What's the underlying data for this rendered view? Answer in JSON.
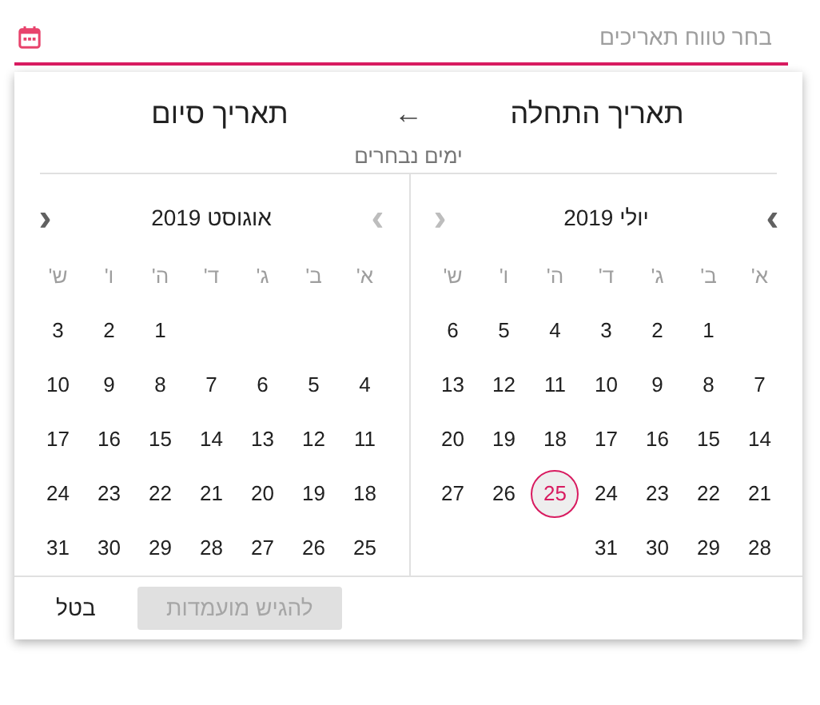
{
  "field": {
    "placeholder": "בחר טווח תאריכים"
  },
  "header": {
    "start_label": "תאריך התחלה",
    "arrow": "←",
    "end_label": "תאריך סיום",
    "subtitle": "ימים נבחרים"
  },
  "months": [
    {
      "title": "יולי 2019",
      "prev": {
        "label": "›",
        "disabled": false
      },
      "next": {
        "label": "‹",
        "disabled": true
      },
      "weekdays": [
        "א'",
        "ב'",
        "ג'",
        "ד'",
        "ה'",
        "ו'",
        "ש'"
      ],
      "weeks": [
        [
          {
            "label": "1",
            "selected": false
          },
          {
            "label": "2",
            "selected": false
          },
          {
            "label": "3",
            "selected": false
          },
          {
            "label": "4",
            "selected": false
          },
          {
            "label": "5",
            "selected": false
          },
          {
            "label": "6",
            "selected": false
          }
        ],
        [
          {
            "label": "7",
            "selected": false
          },
          {
            "label": "8",
            "selected": false
          },
          {
            "label": "9",
            "selected": false
          },
          {
            "label": "10",
            "selected": false
          },
          {
            "label": "11",
            "selected": false
          },
          {
            "label": "12",
            "selected": false
          },
          {
            "label": "13",
            "selected": false
          }
        ],
        [
          {
            "label": "14",
            "selected": false
          },
          {
            "label": "15",
            "selected": false
          },
          {
            "label": "16",
            "selected": false
          },
          {
            "label": "17",
            "selected": false
          },
          {
            "label": "18",
            "selected": false
          },
          {
            "label": "19",
            "selected": false
          },
          {
            "label": "20",
            "selected": false
          }
        ],
        [
          {
            "label": "21",
            "selected": false
          },
          {
            "label": "22",
            "selected": false
          },
          {
            "label": "23",
            "selected": false
          },
          {
            "label": "24",
            "selected": false
          },
          {
            "label": "25",
            "selected": true
          },
          {
            "label": "26",
            "selected": false
          },
          {
            "label": "27",
            "selected": false
          }
        ],
        [
          {
            "label": "28",
            "selected": false
          },
          {
            "label": "29",
            "selected": false
          },
          {
            "label": "30",
            "selected": false
          },
          {
            "label": "31",
            "selected": false
          }
        ]
      ]
    },
    {
      "title": "אוגוסט 2019",
      "prev": {
        "label": "›",
        "disabled": true
      },
      "next": {
        "label": "‹",
        "disabled": false
      },
      "weekdays": [
        "א'",
        "ב'",
        "ג'",
        "ד'",
        "ה'",
        "ו'",
        "ש'"
      ],
      "weeks": [
        [
          {
            "label": "1",
            "selected": false
          },
          {
            "label": "2",
            "selected": false
          },
          {
            "label": "3",
            "selected": false
          }
        ],
        [
          {
            "label": "4",
            "selected": false
          },
          {
            "label": "5",
            "selected": false
          },
          {
            "label": "6",
            "selected": false
          },
          {
            "label": "7",
            "selected": false
          },
          {
            "label": "8",
            "selected": false
          },
          {
            "label": "9",
            "selected": false
          },
          {
            "label": "10",
            "selected": false
          }
        ],
        [
          {
            "label": "11",
            "selected": false
          },
          {
            "label": "12",
            "selected": false
          },
          {
            "label": "13",
            "selected": false
          },
          {
            "label": "14",
            "selected": false
          },
          {
            "label": "15",
            "selected": false
          },
          {
            "label": "16",
            "selected": false
          },
          {
            "label": "17",
            "selected": false
          }
        ],
        [
          {
            "label": "18",
            "selected": false
          },
          {
            "label": "19",
            "selected": false
          },
          {
            "label": "20",
            "selected": false
          },
          {
            "label": "21",
            "selected": false
          },
          {
            "label": "22",
            "selected": false
          },
          {
            "label": "23",
            "selected": false
          },
          {
            "label": "24",
            "selected": false
          }
        ],
        [
          {
            "label": "25",
            "selected": false
          },
          {
            "label": "26",
            "selected": false
          },
          {
            "label": "27",
            "selected": false
          },
          {
            "label": "28",
            "selected": false
          },
          {
            "label": "29",
            "selected": false
          },
          {
            "label": "30",
            "selected": false
          },
          {
            "label": "31",
            "selected": false
          }
        ]
      ]
    }
  ],
  "buttons": [
    {
      "label": "להגיש מועמדות",
      "kind": "primary",
      "disabled": true
    },
    {
      "label": "בטל",
      "kind": "text",
      "disabled": false
    }
  ]
}
